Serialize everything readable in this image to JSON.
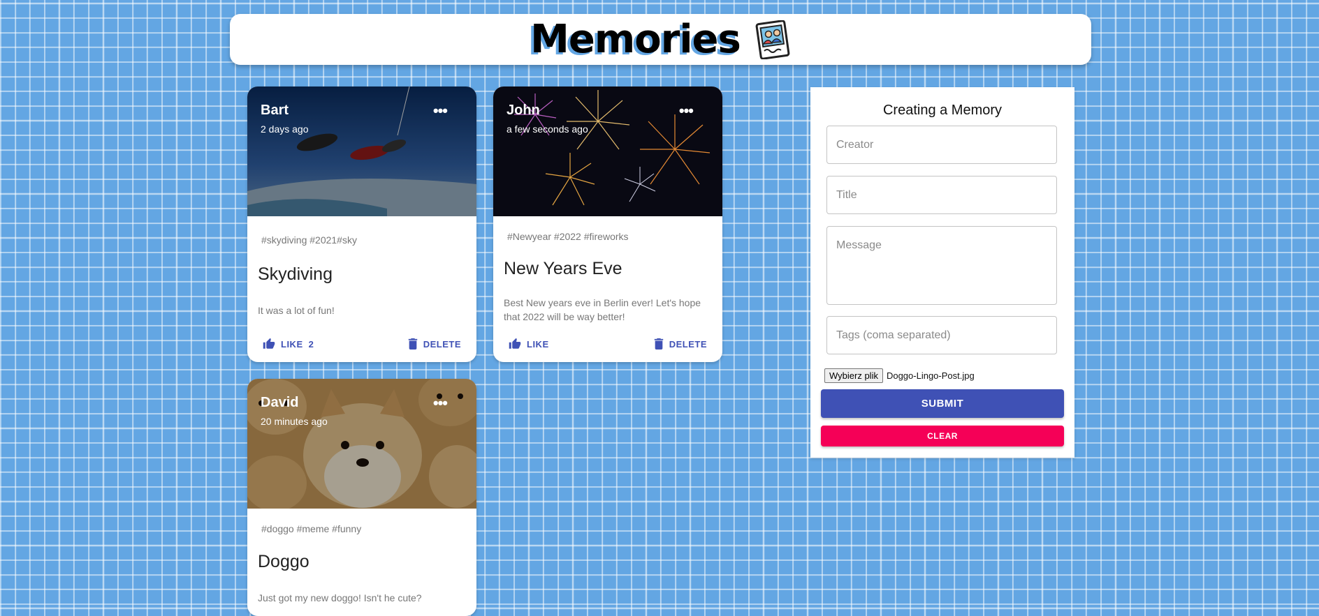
{
  "header": {
    "title": "Memories",
    "logo_icon": "photo-memories-icon"
  },
  "colors": {
    "background": "#63a6e3",
    "primary": "#3f51b5",
    "secondary": "#f50057"
  },
  "posts": [
    {
      "creator": "Bart",
      "time": "2 days ago",
      "tags": "#skydiving #2021#sky",
      "title": "Skydiving",
      "message": "It was a lot of fun!",
      "like_label": "LIKE",
      "like_count": "2",
      "delete_label": "DELETE"
    },
    {
      "creator": "John",
      "time": "a few seconds ago",
      "tags": "#Newyear #2022 #fireworks",
      "title": "New Years Eve",
      "message": "Best New years eve in Berlin ever! Let's hope that 2022 will be way better!",
      "like_label": "LIKE",
      "delete_label": "DELETE"
    },
    {
      "creator": "David",
      "time": "20 minutes ago",
      "tags": "#doggo #meme #funny",
      "title": "Doggo",
      "message": "Just got my new doggo! Isn't he cute?"
    }
  ],
  "form": {
    "heading": "Creating a Memory",
    "creator_placeholder": "Creator",
    "title_placeholder": "Title",
    "message_placeholder": "Message",
    "tags_placeholder": "Tags (coma separated)",
    "file_button": "Wybierz plik",
    "file_name": "Doggo-Lingo-Post.jpg",
    "submit_label": "SUBMIT",
    "clear_label": "CLEAR"
  }
}
